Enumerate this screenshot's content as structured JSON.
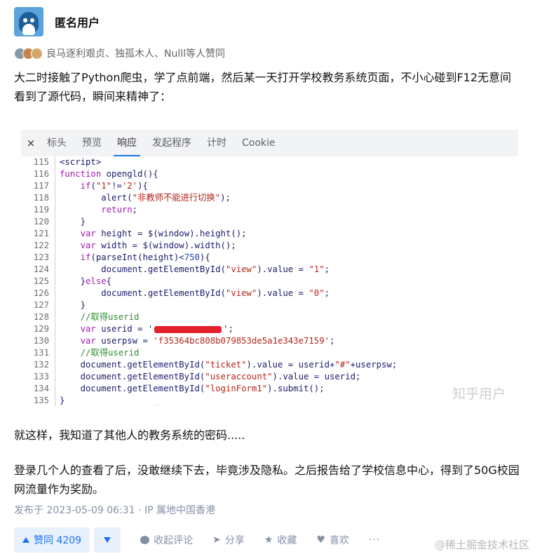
{
  "author": {
    "name": "匿名用户"
  },
  "voters_text": "良马逐利艰贞、独孤木人、Nulll等人赞同",
  "content": {
    "p1": "大二时接触了Python爬虫，学了点前端，然后某一天打开学校教务系统页面，不小心碰到F12无意间看到了源代码，瞬间来精神了：",
    "p2": "就这样，我知道了其他人的教务系统的密码.....",
    "p3": "登录几个人的查看了后，没敢继续下去，毕竟涉及隐私。之后报告给了学校信息中心，得到了50G校园网流量作为奖励。"
  },
  "screenshot": {
    "close": "×",
    "tabs": [
      "标头",
      "预览",
      "响应",
      "发起程序",
      "计时",
      "Cookie"
    ],
    "active_tab": "响应",
    "watermark": "知乎用户",
    "dots": "··",
    "code": [
      {
        "n": "115",
        "t": "<script>"
      },
      {
        "n": "116",
        "t": "function opengld(){"
      },
      {
        "n": "117",
        "t": "    if(\"1\"!='2'){"
      },
      {
        "n": "118",
        "t": "        alert(\"非教师不能进行切换\");"
      },
      {
        "n": "119",
        "t": "        return;"
      },
      {
        "n": "120",
        "t": "    }"
      },
      {
        "n": "121",
        "t": "    var height = $(window).height();"
      },
      {
        "n": "122",
        "t": "    var width = $(window).width();"
      },
      {
        "n": "123",
        "t": "    if(parseInt(height)<750){"
      },
      {
        "n": "124",
        "t": "        document.getElementById(\"view\").value = \"1\";"
      },
      {
        "n": "125",
        "t": "    }else{"
      },
      {
        "n": "126",
        "t": "        document.getElementById(\"view\").value = \"0\";"
      },
      {
        "n": "127",
        "t": "    }"
      },
      {
        "n": "128",
        "t": "    //取得userid"
      },
      {
        "n": "129",
        "t": "    var userid = '[REDACTED]';"
      },
      {
        "n": "130",
        "t": "    var userpsw = 'f35364bc808b079853de5a1e343e7159';"
      },
      {
        "n": "131",
        "t": "    //取得userid"
      },
      {
        "n": "132",
        "t": "    document.getElementById(\"ticket\").value = userid+\"#\"+userpsw;"
      },
      {
        "n": "133",
        "t": "    document.getElementById(\"useraccount\").value = userid;"
      },
      {
        "n": "134",
        "t": "    document.getElementById(\"loginForm1\").submit();"
      },
      {
        "n": "135",
        "t": "}"
      }
    ]
  },
  "meta": "发布于 2023-05-09 06:31 · IP 属地中国香港",
  "actions": {
    "vote_up": "赞同 4209",
    "comment": "收起评论",
    "share": "分享",
    "collect": "收藏",
    "like": "喜欢",
    "more": "···"
  },
  "footer_watermark": "@稀土掘金技术社区"
}
